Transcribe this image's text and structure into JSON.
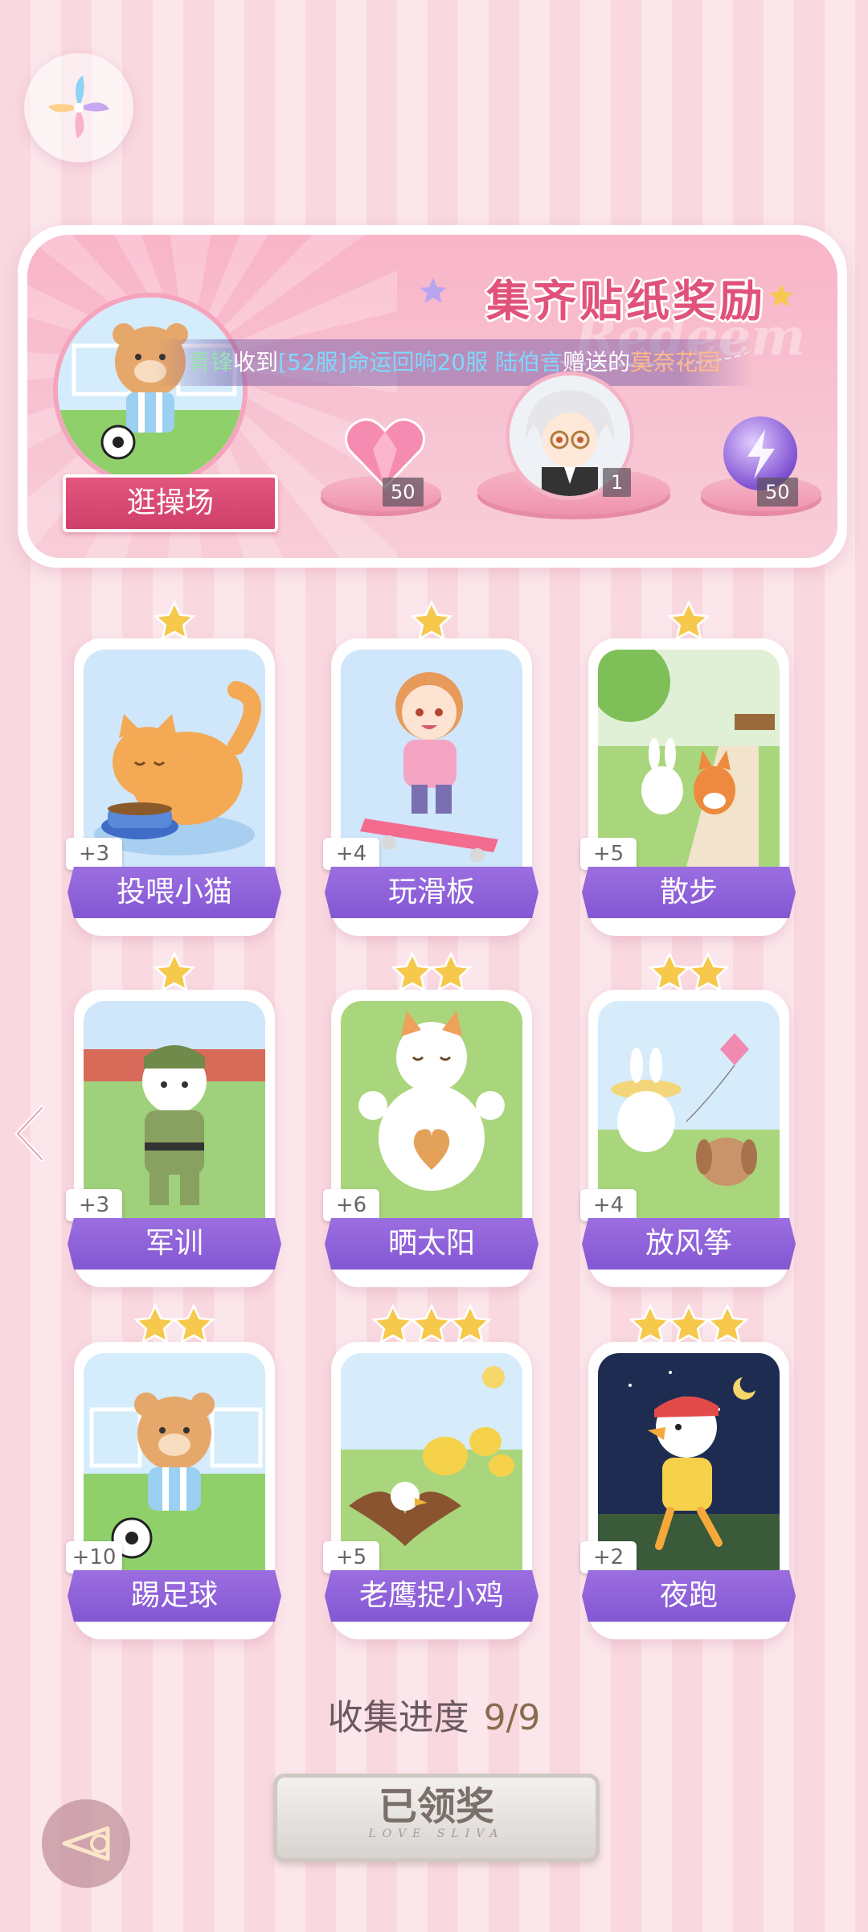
{
  "header": {
    "logo_icon": "pinwheel-icon"
  },
  "banner": {
    "title": "集齐贴纸奖励",
    "watermark": "Redeem",
    "event_label": "逛操场",
    "marquee": {
      "sender": "青锋",
      "verb": "收到",
      "server_gift": "[52服]命运回响20服",
      "receiver": "陆伯言",
      "verb2": "赠送的",
      "item": "莫奈花园"
    },
    "rewards": [
      {
        "icon": "pink-heart-gem-icon",
        "count": "50"
      },
      {
        "icon": "character-avatar",
        "count": "1"
      },
      {
        "icon": "purple-energy-orb-icon",
        "count": "50"
      }
    ]
  },
  "cards": [
    {
      "label": "投喂小猫",
      "points": "+3",
      "stars": 1,
      "scene": "cat-eating"
    },
    {
      "label": "玩滑板",
      "points": "+4",
      "stars": 1,
      "scene": "girl-skateboard"
    },
    {
      "label": "散步",
      "points": "+5",
      "stars": 1,
      "scene": "bunny-fox-walk"
    },
    {
      "label": "军训",
      "points": "+3",
      "stars": 1,
      "scene": "cat-soldier"
    },
    {
      "label": "晒太阳",
      "points": "+6",
      "stars": 2,
      "scene": "cat-sunbathing"
    },
    {
      "label": "放风筝",
      "points": "+4",
      "stars": 2,
      "scene": "bunny-kite"
    },
    {
      "label": "踢足球",
      "points": "+10",
      "stars": 2,
      "scene": "bear-soccer"
    },
    {
      "label": "老鹰捉小鸡",
      "points": "+5",
      "stars": 3,
      "scene": "eagle-chicks"
    },
    {
      "label": "夜跑",
      "points": "+2",
      "stars": 3,
      "scene": "duck-night-run"
    }
  ],
  "progress": {
    "label": "收集进度",
    "value": "9/9"
  },
  "claim_button": {
    "label": "已领奖",
    "subtitle": "LOVE SLIVA"
  },
  "colors": {
    "accent_pink": "#e0527a",
    "card_label_purple": "#8f62d9",
    "star_gold": "#f6c84c"
  }
}
